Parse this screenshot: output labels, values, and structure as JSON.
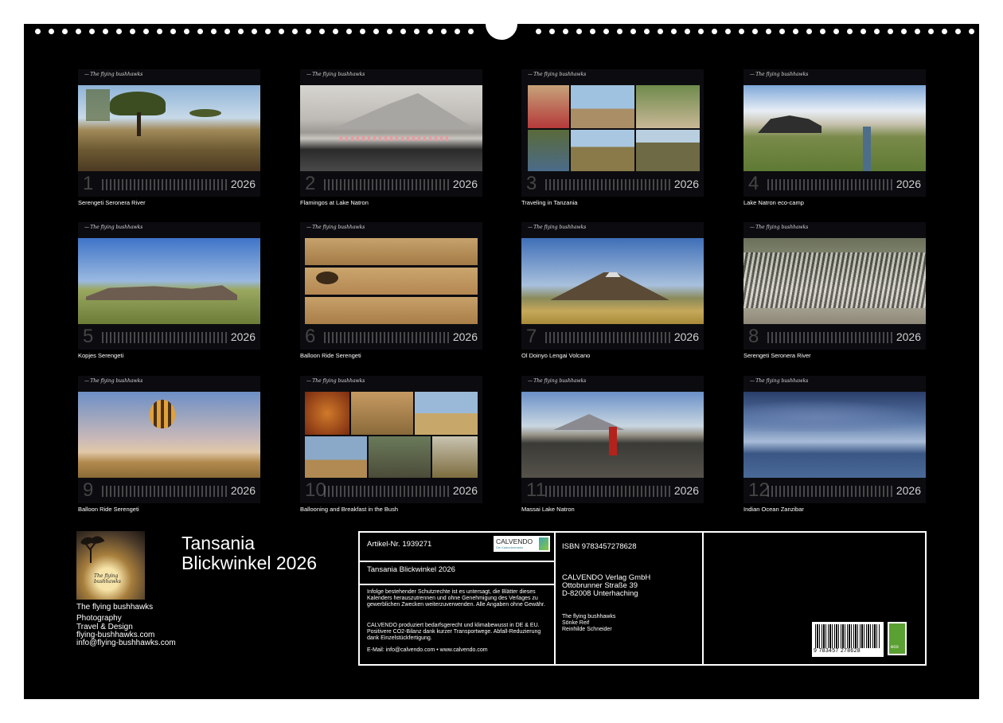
{
  "calendar": {
    "brand": "The flying bushhawks",
    "year": "2026",
    "months": [
      {
        "num": "1",
        "caption": "Serengeti Seronera River"
      },
      {
        "num": "2",
        "caption": "Flamingos at Lake Natron"
      },
      {
        "num": "3",
        "caption": "Traveling in Tanzania"
      },
      {
        "num": "4",
        "caption": "Lake Natron eco-camp"
      },
      {
        "num": "5",
        "caption": "Kopjes Serengeti"
      },
      {
        "num": "6",
        "caption": "Balloon Ride Serengeti"
      },
      {
        "num": "7",
        "caption": "Ol Doinyo Lengai Volcano"
      },
      {
        "num": "8",
        "caption": "Serengeti Seronera River"
      },
      {
        "num": "9",
        "caption": "Balloon Ride Serengeti"
      },
      {
        "num": "10",
        "caption": "Ballooning and Breakfast in the Bush"
      },
      {
        "num": "11",
        "caption": "Massai Lake Natron"
      },
      {
        "num": "12",
        "caption": "Indian Ocean Zanzibar"
      }
    ]
  },
  "cover": {
    "image_text": "The flying bushhawks",
    "title_line1": "Tansania",
    "title_line2": "Blickwinkel 2026"
  },
  "author": {
    "name": "The flying bushhawks",
    "line1": "Photography",
    "line2": "Travel & Design",
    "web": "flying-bushhawks.com",
    "email": "info@flying-bushhawks.com"
  },
  "imprint": {
    "article": "Artikel-Nr. 1939271",
    "calvendo_logo": "CALVENDO",
    "calvendo_sub": "Die Kalendermarke",
    "product_title": "Tansania Blickwinkel 2026",
    "legal_text": "Infolge bestehender Schutzrechte ist es untersagt, die Blätter dieses Kalenders herauszutrennen und ohne Genehmigung des Verlages zu gewerblichen Zwecken weiterzuverwenden. Alle Angaben ohne Gewähr.",
    "eco_text": "CALVENDO produziert bedarfsgerecht und klimabewusst in DE & EU. Positivere CO2-Bilanz dank kurzer Transportwege. Abfall-Reduzierung dank Einzelstückfertigung.",
    "contact": "E-Mail: info@calvendo.com • www.calvendo.com",
    "isbn": "ISBN 9783457278628",
    "publisher": "CALVENDO Verlag GmbH",
    "street": "Ottobrunner Straße 39",
    "city": "D-82008 Unterhaching",
    "credits_1": "The flying bushhawks",
    "credits_2": "Sönke Reif",
    "credits_3": "Reinhilde Schneider",
    "barcode_digits": "9 783457 278628",
    "eco_label": "eco"
  }
}
